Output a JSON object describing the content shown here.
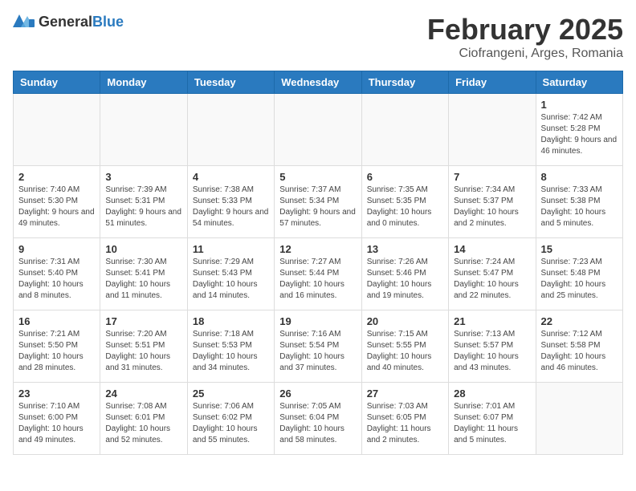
{
  "header": {
    "logo_general": "General",
    "logo_blue": "Blue",
    "title": "February 2025",
    "subtitle": "Ciofrangeni, Arges, Romania"
  },
  "calendar": {
    "days_of_week": [
      "Sunday",
      "Monday",
      "Tuesday",
      "Wednesday",
      "Thursday",
      "Friday",
      "Saturday"
    ],
    "weeks": [
      [
        {
          "day": "",
          "info": ""
        },
        {
          "day": "",
          "info": ""
        },
        {
          "day": "",
          "info": ""
        },
        {
          "day": "",
          "info": ""
        },
        {
          "day": "",
          "info": ""
        },
        {
          "day": "",
          "info": ""
        },
        {
          "day": "1",
          "info": "Sunrise: 7:42 AM\nSunset: 5:28 PM\nDaylight: 9 hours and 46 minutes."
        }
      ],
      [
        {
          "day": "2",
          "info": "Sunrise: 7:40 AM\nSunset: 5:30 PM\nDaylight: 9 hours and 49 minutes."
        },
        {
          "day": "3",
          "info": "Sunrise: 7:39 AM\nSunset: 5:31 PM\nDaylight: 9 hours and 51 minutes."
        },
        {
          "day": "4",
          "info": "Sunrise: 7:38 AM\nSunset: 5:33 PM\nDaylight: 9 hours and 54 minutes."
        },
        {
          "day": "5",
          "info": "Sunrise: 7:37 AM\nSunset: 5:34 PM\nDaylight: 9 hours and 57 minutes."
        },
        {
          "day": "6",
          "info": "Sunrise: 7:35 AM\nSunset: 5:35 PM\nDaylight: 10 hours and 0 minutes."
        },
        {
          "day": "7",
          "info": "Sunrise: 7:34 AM\nSunset: 5:37 PM\nDaylight: 10 hours and 2 minutes."
        },
        {
          "day": "8",
          "info": "Sunrise: 7:33 AM\nSunset: 5:38 PM\nDaylight: 10 hours and 5 minutes."
        }
      ],
      [
        {
          "day": "9",
          "info": "Sunrise: 7:31 AM\nSunset: 5:40 PM\nDaylight: 10 hours and 8 minutes."
        },
        {
          "day": "10",
          "info": "Sunrise: 7:30 AM\nSunset: 5:41 PM\nDaylight: 10 hours and 11 minutes."
        },
        {
          "day": "11",
          "info": "Sunrise: 7:29 AM\nSunset: 5:43 PM\nDaylight: 10 hours and 14 minutes."
        },
        {
          "day": "12",
          "info": "Sunrise: 7:27 AM\nSunset: 5:44 PM\nDaylight: 10 hours and 16 minutes."
        },
        {
          "day": "13",
          "info": "Sunrise: 7:26 AM\nSunset: 5:46 PM\nDaylight: 10 hours and 19 minutes."
        },
        {
          "day": "14",
          "info": "Sunrise: 7:24 AM\nSunset: 5:47 PM\nDaylight: 10 hours and 22 minutes."
        },
        {
          "day": "15",
          "info": "Sunrise: 7:23 AM\nSunset: 5:48 PM\nDaylight: 10 hours and 25 minutes."
        }
      ],
      [
        {
          "day": "16",
          "info": "Sunrise: 7:21 AM\nSunset: 5:50 PM\nDaylight: 10 hours and 28 minutes."
        },
        {
          "day": "17",
          "info": "Sunrise: 7:20 AM\nSunset: 5:51 PM\nDaylight: 10 hours and 31 minutes."
        },
        {
          "day": "18",
          "info": "Sunrise: 7:18 AM\nSunset: 5:53 PM\nDaylight: 10 hours and 34 minutes."
        },
        {
          "day": "19",
          "info": "Sunrise: 7:16 AM\nSunset: 5:54 PM\nDaylight: 10 hours and 37 minutes."
        },
        {
          "day": "20",
          "info": "Sunrise: 7:15 AM\nSunset: 5:55 PM\nDaylight: 10 hours and 40 minutes."
        },
        {
          "day": "21",
          "info": "Sunrise: 7:13 AM\nSunset: 5:57 PM\nDaylight: 10 hours and 43 minutes."
        },
        {
          "day": "22",
          "info": "Sunrise: 7:12 AM\nSunset: 5:58 PM\nDaylight: 10 hours and 46 minutes."
        }
      ],
      [
        {
          "day": "23",
          "info": "Sunrise: 7:10 AM\nSunset: 6:00 PM\nDaylight: 10 hours and 49 minutes."
        },
        {
          "day": "24",
          "info": "Sunrise: 7:08 AM\nSunset: 6:01 PM\nDaylight: 10 hours and 52 minutes."
        },
        {
          "day": "25",
          "info": "Sunrise: 7:06 AM\nSunset: 6:02 PM\nDaylight: 10 hours and 55 minutes."
        },
        {
          "day": "26",
          "info": "Sunrise: 7:05 AM\nSunset: 6:04 PM\nDaylight: 10 hours and 58 minutes."
        },
        {
          "day": "27",
          "info": "Sunrise: 7:03 AM\nSunset: 6:05 PM\nDaylight: 11 hours and 2 minutes."
        },
        {
          "day": "28",
          "info": "Sunrise: 7:01 AM\nSunset: 6:07 PM\nDaylight: 11 hours and 5 minutes."
        },
        {
          "day": "",
          "info": ""
        }
      ]
    ]
  }
}
